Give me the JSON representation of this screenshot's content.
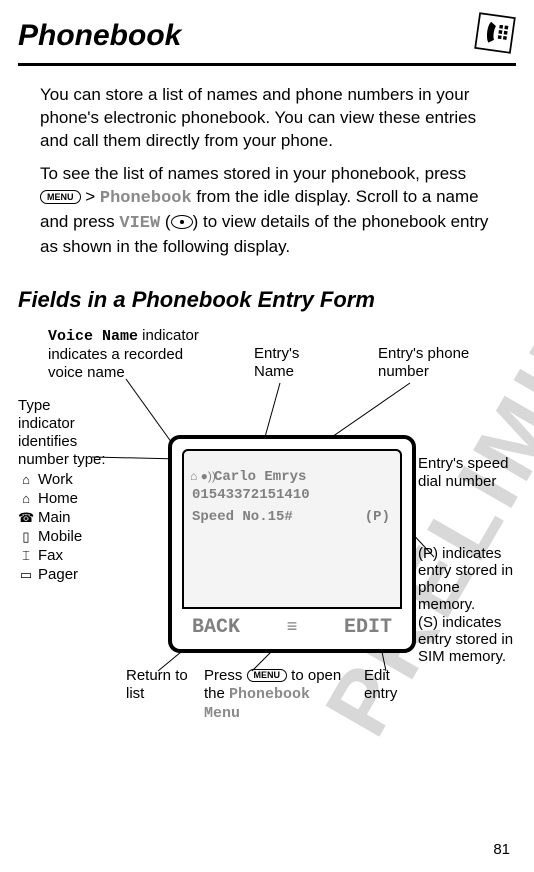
{
  "watermark": "PRELIMINARY",
  "page_number": "81",
  "title": "Phonebook",
  "intro_para1": "You can store a list of names and phone numbers in your phone's electronic phonebook. You can view these entries and call them directly from your phone.",
  "intro_para2_pre": "To see the list of names stored in your phonebook, press ",
  "intro_para2_gt": " > ",
  "intro_para2_phonebook": "Phonebook",
  "intro_para2_mid1": " from the idle display. Scroll to a name and press ",
  "intro_para2_view": "VIEW",
  "intro_para2_paren_open": " (",
  "intro_para2_paren_close": ") to view details of the phonebook entry as shown in the following display.",
  "section_title": "Fields in a Phonebook Entry Form",
  "callouts": {
    "voice_name_pre": "Voice Name",
    "voice_name_post": " indicator indicates a recorded voice name",
    "entry_name": "Entry's Name",
    "entry_phone": "Entry's phone number",
    "type_label": "Type indicator identifies number type:",
    "speed": "Entry's speed dial number",
    "memory_p": "(P)",
    "memory_p_txt": " indicates entry stored in phone memory.",
    "memory_s": "(S) indicates entry stored in SIM memory.",
    "return": "Return to list",
    "press_pre": "Press ",
    "press_post": " to open the ",
    "pb_menu1": "Phonebook",
    "pb_menu2": "Menu",
    "edit": "Edit entry"
  },
  "types": {
    "work": "Work",
    "home": "Home",
    "main": "Main",
    "mobile": "Mobile",
    "fax": "Fax",
    "pager": "Pager"
  },
  "screen": {
    "name": "Carlo Emrys",
    "number": "01543372151410",
    "speed": "Speed No.15#",
    "p": "(P)",
    "back": "BACK",
    "edit": "EDIT"
  }
}
